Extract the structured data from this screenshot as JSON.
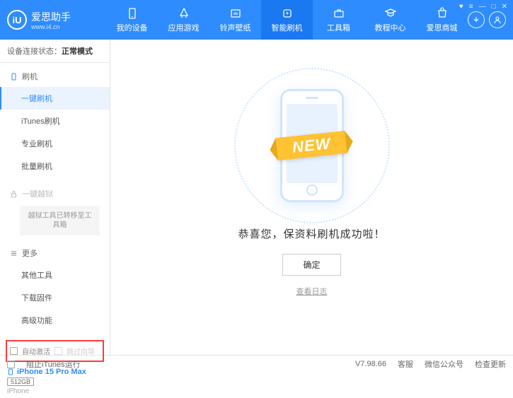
{
  "header": {
    "logo_text": "爱思助手",
    "logo_url": "www.i4.cn",
    "logo_letter": "iU",
    "nav": [
      {
        "label": "我的设备"
      },
      {
        "label": "应用游戏"
      },
      {
        "label": "铃声壁纸"
      },
      {
        "label": "智能刷机"
      },
      {
        "label": "工具箱"
      },
      {
        "label": "教程中心"
      },
      {
        "label": "爱思商城"
      }
    ]
  },
  "sidebar": {
    "status_label": "设备连接状态：",
    "status_value": "正常模式",
    "section_flash": "刷机",
    "items_flash": [
      "一键刷机",
      "iTunes刷机",
      "专业刷机",
      "批量刷机"
    ],
    "section_jailbreak": "一键越狱",
    "jailbreak_note": "越狱工具已转移至工具箱",
    "section_more": "更多",
    "items_more": [
      "其他工具",
      "下载固件",
      "高级功能"
    ],
    "checkbox1": "自动激活",
    "checkbox2": "跳过向导",
    "device_name": "iPhone 15 Pro Max",
    "device_storage": "512GB",
    "device_type": "iPhone"
  },
  "main": {
    "banner_text": "NEW",
    "success_message": "恭喜您，保资料刷机成功啦！",
    "ok_button": "确定",
    "log_link": "查看日志"
  },
  "footer": {
    "block_itunes": "阻止iTunes运行",
    "version": "V7.98.66",
    "service": "客服",
    "wechat": "微信公众号",
    "update": "检查更新"
  }
}
